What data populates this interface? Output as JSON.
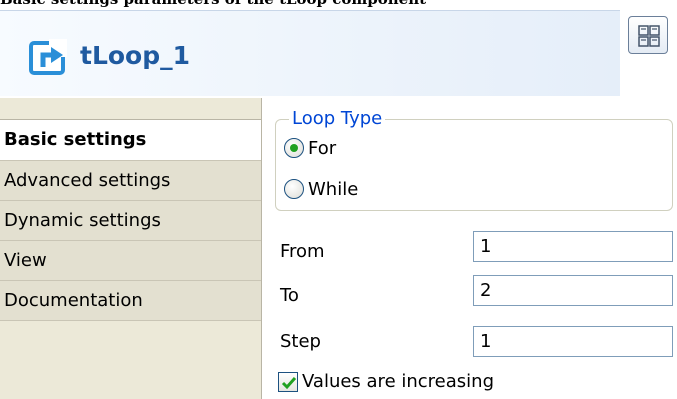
{
  "top_caption": "Basic settings parameters of the tLoop component",
  "header": {
    "title": "tLoop_1",
    "component_icon": "tloop-component-icon",
    "layout_button_icon": "layout-grid-icon"
  },
  "tabs": [
    {
      "label": "Basic settings",
      "selected": true
    },
    {
      "label": "Advanced settings",
      "selected": false
    },
    {
      "label": "Dynamic settings",
      "selected": false
    },
    {
      "label": "View",
      "selected": false
    },
    {
      "label": "Documentation",
      "selected": false
    }
  ],
  "loop_type": {
    "legend": "Loop Type",
    "options": [
      {
        "label": "For",
        "selected": true
      },
      {
        "label": "While",
        "selected": false
      }
    ]
  },
  "fields": {
    "from": {
      "label": "From",
      "value": "1"
    },
    "to": {
      "label": "To",
      "value": "2"
    },
    "step": {
      "label": "Step",
      "value": "1"
    }
  },
  "values_increasing": {
    "label": "Values are increasing",
    "checked": true
  },
  "colors": {
    "header_title": "#1f5aa0",
    "legend": "#0046d5",
    "tab_bg": "#e3e0d0",
    "radio_dot": "#21a121",
    "check_mark": "#21a121"
  }
}
